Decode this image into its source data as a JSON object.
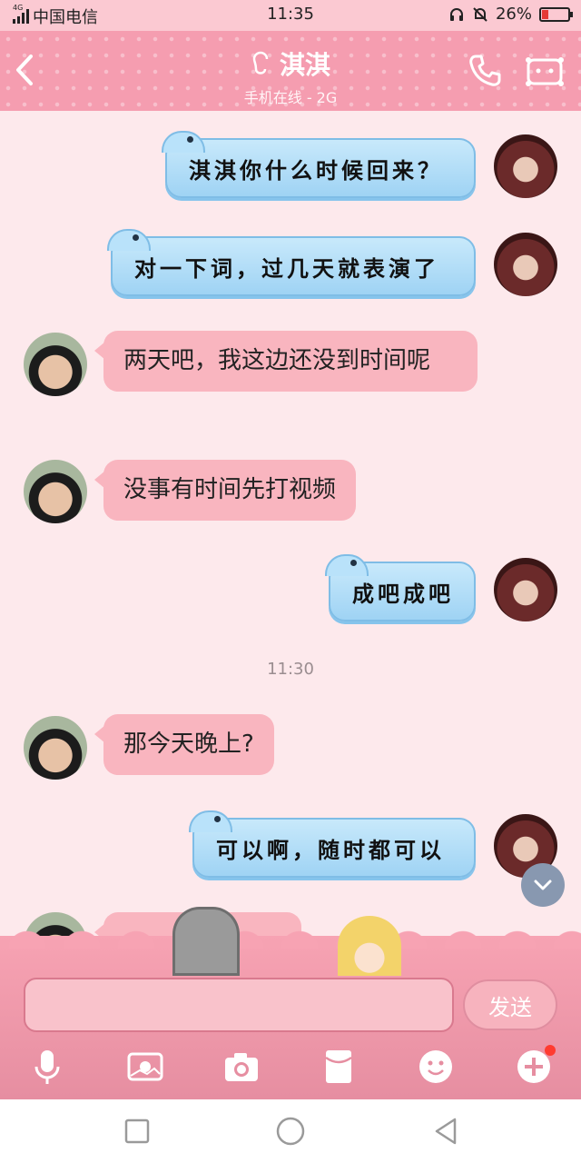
{
  "status_bar": {
    "network": "4G",
    "carrier": "中国电信",
    "time": "11:35",
    "battery": "26%"
  },
  "header": {
    "title": "淇淇",
    "subtitle": "手机在线 - 2G"
  },
  "messages": [
    {
      "side": "right",
      "text": "淇淇你什么时候回来？"
    },
    {
      "side": "right",
      "text": "对一下词，过几天就表演了"
    },
    {
      "side": "left",
      "text": "两天吧，我这边还没到时间呢"
    },
    {
      "side": "left",
      "text": "没事有时间先打视频"
    },
    {
      "side": "right",
      "text": "成吧成吧"
    },
    {
      "side": "center",
      "text": "11:30"
    },
    {
      "side": "left",
      "text": "那今天晚上?"
    },
    {
      "side": "right",
      "text": "可以啊，随时都可以"
    }
  ],
  "input": {
    "value": "",
    "send_label": "发送"
  },
  "toolbar": [
    "mic-icon",
    "photo-icon",
    "camera-icon",
    "red-packet-icon",
    "emoji-icon",
    "plus-icon"
  ],
  "colors": {
    "header": "#f59db0",
    "chat_bg": "#fde9ec",
    "blue_bubble": "#aedcf8",
    "pink_bubble": "#f9b5bf"
  }
}
